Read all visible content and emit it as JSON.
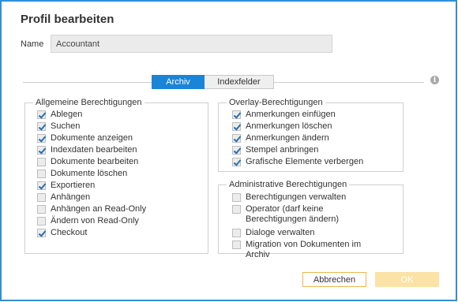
{
  "dialog": {
    "title": "Profil bearbeiten",
    "name_label": "Name",
    "name_value": "Accountant"
  },
  "tabs": [
    {
      "label": "Archiv",
      "active": true
    },
    {
      "label": "Indexfelder",
      "active": false
    }
  ],
  "info_icon": "info-icon",
  "general": {
    "title": "Allgemeine Berechtigungen",
    "items": [
      {
        "label": "Ablegen",
        "checked": true
      },
      {
        "label": "Suchen",
        "checked": true
      },
      {
        "label": "Dokumente anzeigen",
        "checked": true
      },
      {
        "label": "Indexdaten bearbeiten",
        "checked": true
      },
      {
        "label": "Dokumente bearbeiten",
        "checked": false
      },
      {
        "label": "Dokumente löschen",
        "checked": false
      },
      {
        "label": "Exportieren",
        "checked": true
      },
      {
        "label": "Anhängen",
        "checked": false
      },
      {
        "label": "Anhängen an Read-Only",
        "checked": false
      },
      {
        "label": "Ändern von Read-Only",
        "checked": false
      },
      {
        "label": "Checkout",
        "checked": true
      }
    ]
  },
  "overlay": {
    "title": "Overlay-Berechtigungen",
    "items": [
      {
        "label": "Anmerkungen einfügen",
        "checked": true
      },
      {
        "label": "Anmerkungen löschen",
        "checked": true
      },
      {
        "label": "Anmerkungen ändern",
        "checked": true
      },
      {
        "label": "Stempel anbringen",
        "checked": true
      },
      {
        "label": "Grafische Elemente verbergen",
        "checked": true
      }
    ]
  },
  "admin": {
    "title": "Administrative Berechtigungen",
    "items": [
      {
        "label": "Berechtigungen verwalten",
        "checked": false
      },
      {
        "label": "Operator (darf keine Berechtigungen ändern)",
        "checked": false
      },
      {
        "label": "Dialoge verwalten",
        "checked": false
      },
      {
        "label": "Migration von Dokumenten im Archiv",
        "checked": false
      }
    ]
  },
  "buttons": {
    "cancel": "Abbrechen",
    "ok": "OK"
  },
  "colors": {
    "accent": "#1a85d6",
    "border": "#2f8fd8",
    "ok_disabled": "#fbe3a6",
    "cancel_border": "#e8b84a"
  }
}
